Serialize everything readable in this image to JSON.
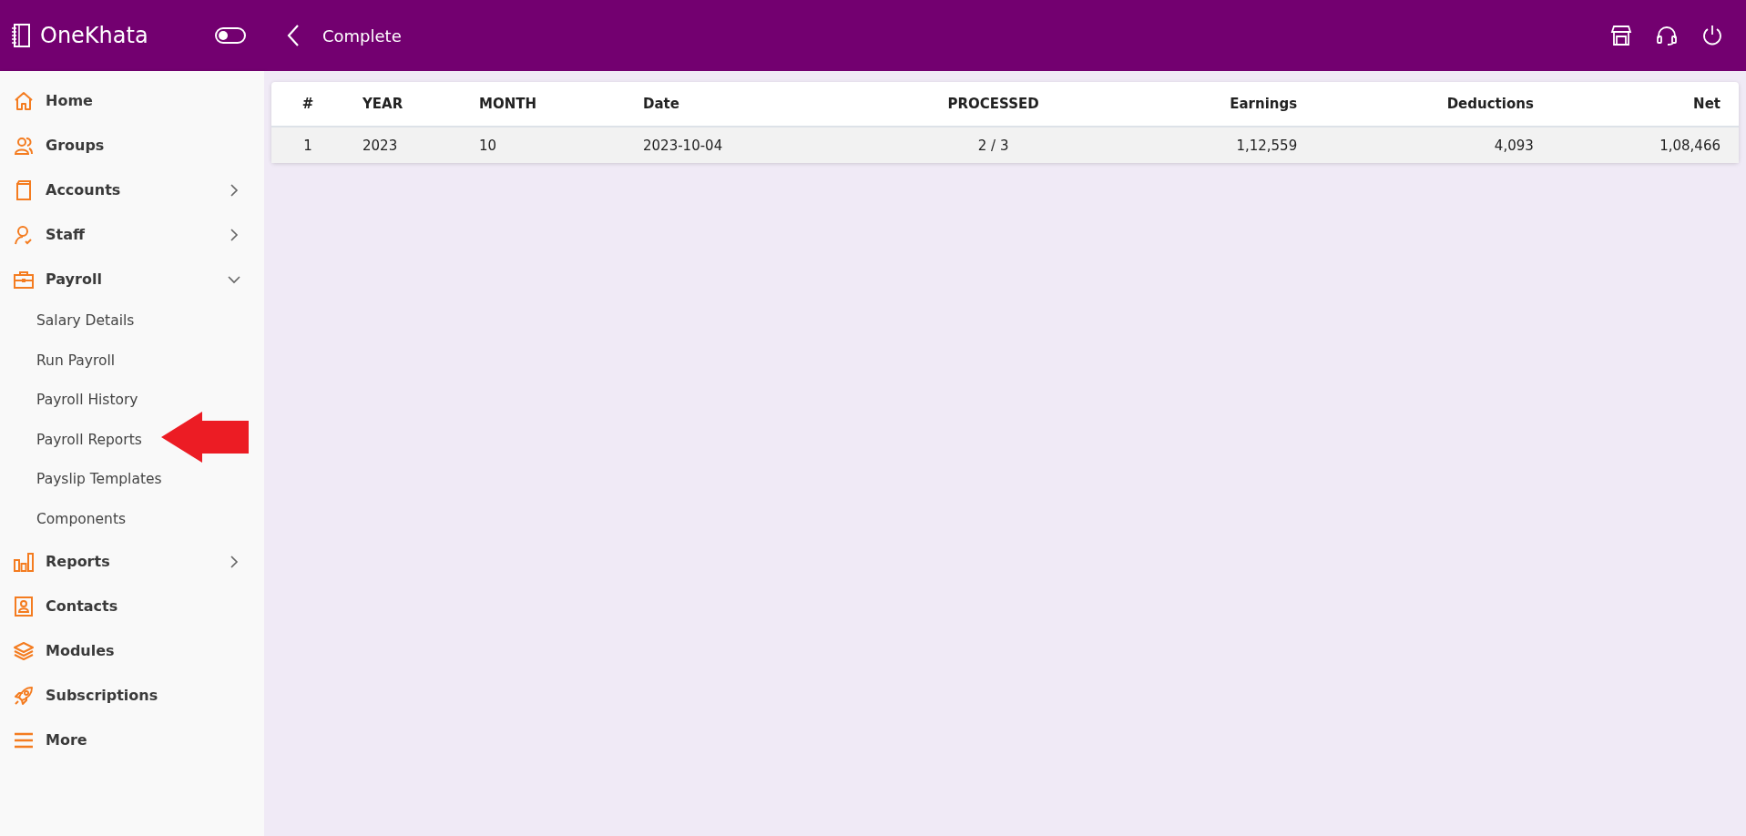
{
  "app": {
    "name": "OneKhata"
  },
  "theme_toggle": {
    "on": false
  },
  "page": {
    "title": "Complete"
  },
  "sidebar": {
    "items": [
      {
        "label": "Home"
      },
      {
        "label": "Groups"
      },
      {
        "label": "Accounts",
        "expanded": false
      },
      {
        "label": "Staff",
        "expanded": false
      },
      {
        "label": "Payroll",
        "expanded": true,
        "children": [
          {
            "label": "Salary Details"
          },
          {
            "label": "Run Payroll"
          },
          {
            "label": "Payroll History"
          },
          {
            "label": "Payroll Reports"
          },
          {
            "label": "Payslip Templates"
          },
          {
            "label": "Components"
          }
        ]
      },
      {
        "label": "Reports",
        "expanded": false
      },
      {
        "label": "Contacts"
      },
      {
        "label": "Modules"
      },
      {
        "label": "Subscriptions"
      },
      {
        "label": "More"
      }
    ]
  },
  "table": {
    "columns": [
      "#",
      "YEAR",
      "MONTH",
      "Date",
      "PROCESSED",
      "Earnings",
      "Deductions",
      "Net"
    ],
    "rows": [
      [
        "1",
        "2023",
        "10",
        "2023-10-04",
        "2 / 3",
        "1,12,559",
        "4,093",
        "1,08,466"
      ]
    ]
  }
}
